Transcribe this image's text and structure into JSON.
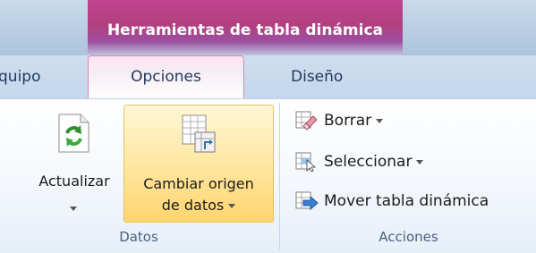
{
  "context_header": {
    "title": "Herramientas de tabla dinámica",
    "color": "#b2407f"
  },
  "tabs": [
    {
      "label": "quipo",
      "active": false
    },
    {
      "label": "Opciones",
      "active": true
    },
    {
      "label": "Diseño",
      "active": false
    }
  ],
  "groups": {
    "datos": {
      "label": "Datos",
      "buttons": [
        {
          "line1": "Actualizar",
          "line2": "",
          "icon": "refresh-icon",
          "has_dropdown": true
        },
        {
          "line1": "Cambiar origen",
          "line2": "de datos",
          "icon": "change-data-source-icon",
          "has_dropdown": true,
          "highlighted": true
        }
      ]
    },
    "acciones": {
      "label": "Acciones",
      "buttons": [
        {
          "label": "Borrar",
          "icon": "clear-icon",
          "has_dropdown": true
        },
        {
          "label": "Seleccionar",
          "icon": "select-icon",
          "has_dropdown": true
        },
        {
          "label": "Mover tabla dinámica",
          "icon": "move-pivot-table-icon",
          "has_dropdown": false
        }
      ]
    }
  }
}
